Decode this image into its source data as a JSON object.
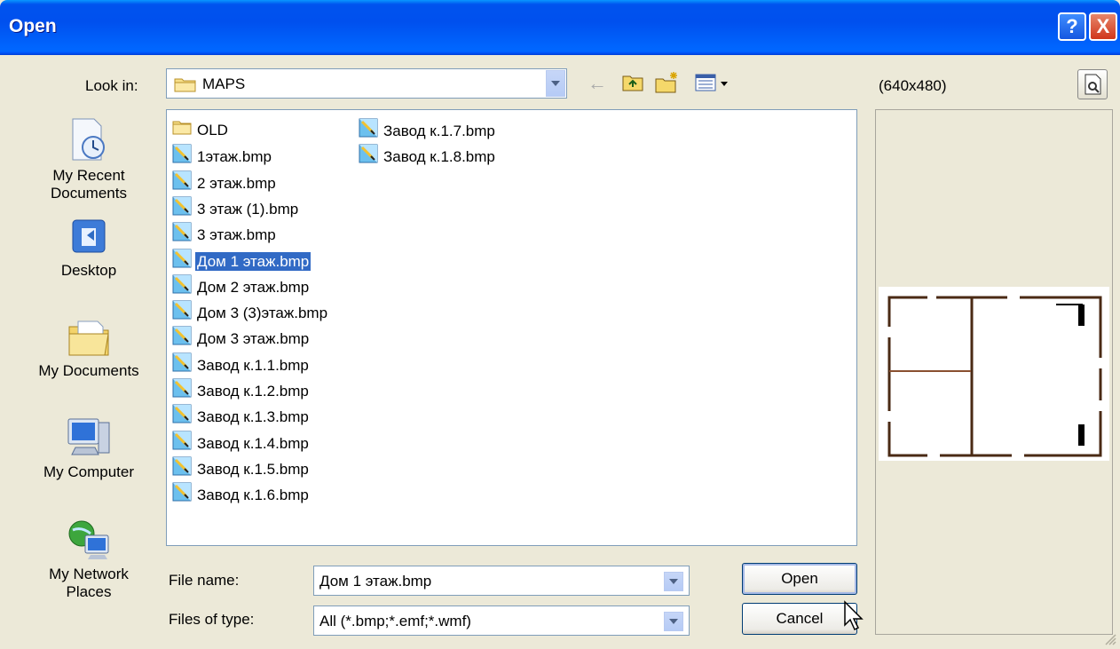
{
  "window": {
    "title": "Open"
  },
  "title_buttons": {
    "help": "?",
    "close": "X",
    "help_icon": "question-icon",
    "close_icon": "close-icon"
  },
  "look_in": {
    "label": "Look in:",
    "value": "MAPS",
    "icon": "folder-icon"
  },
  "toolbar": {
    "back_icon": "back-arrow-icon",
    "up_icon": "up-folder-icon",
    "new_folder_icon": "new-folder-icon",
    "view_icon": "view-menu-icon",
    "back_glyph": "←"
  },
  "preview": {
    "size_label": "(640x480)",
    "toggle_icon": "preview-toggle-icon"
  },
  "places": [
    {
      "label": "My Recent Documents",
      "icon": "recent-documents-icon"
    },
    {
      "label": "Desktop",
      "icon": "desktop-icon"
    },
    {
      "label": "My Documents",
      "icon": "my-documents-icon"
    },
    {
      "label": "My Computer",
      "icon": "my-computer-icon"
    },
    {
      "label": "My Network Places",
      "icon": "network-places-icon"
    }
  ],
  "files": [
    {
      "name": "OLD",
      "type": "folder"
    },
    {
      "name": "1этаж.bmp",
      "type": "bmp"
    },
    {
      "name": "2 этаж.bmp",
      "type": "bmp"
    },
    {
      "name": "3 этаж (1).bmp",
      "type": "bmp"
    },
    {
      "name": "3 этаж.bmp",
      "type": "bmp"
    },
    {
      "name": "Дом 1 этаж.bmp",
      "type": "bmp",
      "selected": true
    },
    {
      "name": "Дом 2 этаж.bmp",
      "type": "bmp"
    },
    {
      "name": "Дом 3 (3)этаж.bmp",
      "type": "bmp"
    },
    {
      "name": "Дом 3 этаж.bmp",
      "type": "bmp"
    },
    {
      "name": "Завод к.1.1.bmp",
      "type": "bmp"
    },
    {
      "name": "Завод к.1.2.bmp",
      "type": "bmp"
    },
    {
      "name": "Завод к.1.3.bmp",
      "type": "bmp"
    },
    {
      "name": "Завод к.1.4.bmp",
      "type": "bmp"
    },
    {
      "name": "Завод к.1.5.bmp",
      "type": "bmp"
    },
    {
      "name": "Завод к.1.6.bmp",
      "type": "bmp"
    },
    {
      "name": "Завод к.1.7.bmp",
      "type": "bmp"
    },
    {
      "name": "Завод к.1.8.bmp",
      "type": "bmp"
    }
  ],
  "file_name": {
    "label": "File name:",
    "value": "Дом 1 этаж.bmp"
  },
  "file_type": {
    "label": "Files of type:",
    "value": "All (*.bmp;*.emf;*.wmf)"
  },
  "buttons": {
    "open": "Open",
    "cancel": "Cancel"
  },
  "colors": {
    "title_bar": "#0055EA",
    "selection": "#316AC5",
    "dialog_bg": "#ECE9D8",
    "close_button": "#D0361B"
  }
}
